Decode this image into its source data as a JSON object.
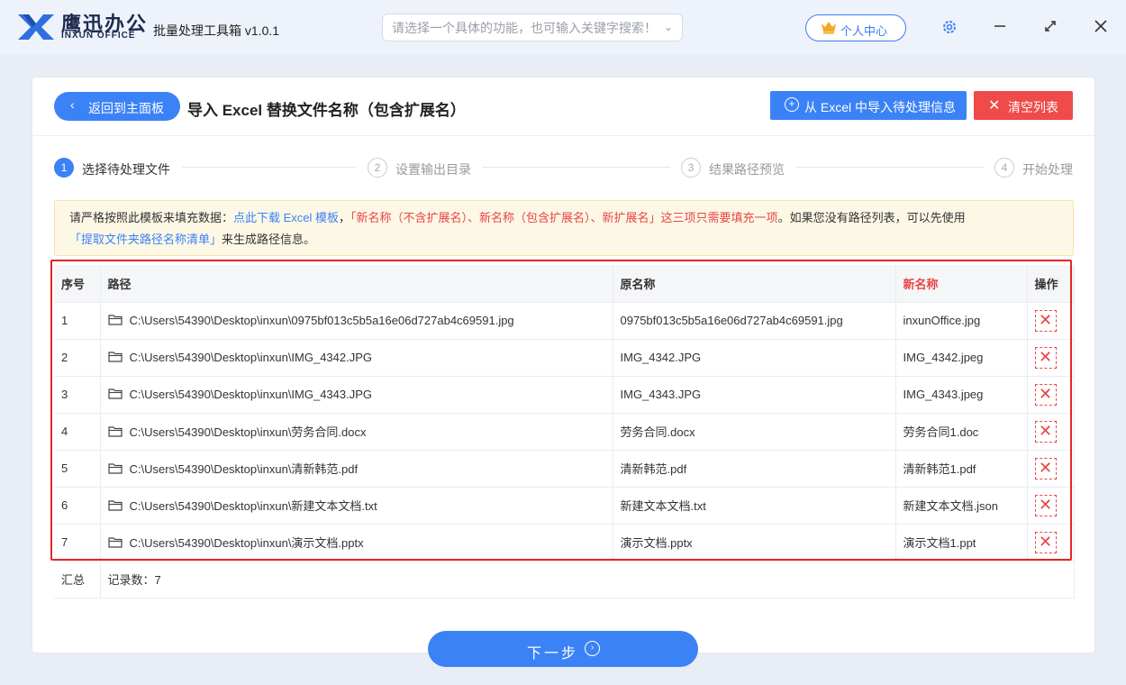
{
  "titlebar": {
    "brand_cn": "鹰迅办公",
    "brand_en": "INXUN OFFICE",
    "app_title": "批量处理工具箱 v1.0.1",
    "search_placeholder": "请选择一个具体的功能，也可输入关键字搜索！",
    "user_center": "个人中心"
  },
  "header": {
    "back_label": "返回到主面板",
    "page_title": "导入 Excel 替换文件名称（包含扩展名）",
    "import_label": "从 Excel 中导入待处理信息",
    "clear_label": "清空列表"
  },
  "steps": [
    {
      "num": "1",
      "label": "选择待处理文件"
    },
    {
      "num": "2",
      "label": "设置输出目录"
    },
    {
      "num": "3",
      "label": "结果路径预览"
    },
    {
      "num": "4",
      "label": "开始处理"
    }
  ],
  "notice": {
    "part1": "请严格按照此模板来填充数据：",
    "link1": "点此下载 Excel 模板",
    "part2": "，",
    "red": "「新名称（不含扩展名）、新名称（包含扩展名）、新扩展名」这三项只需要填充一项",
    "part3": "。如果您没有路径列表，可以先使用",
    "link2": "「提取文件夹路径名称清单」",
    "part4": "来生成路径信息。"
  },
  "table": {
    "headers": {
      "index": "序号",
      "path": "路径",
      "original": "原名称",
      "newname": "新名称",
      "action": "操作"
    },
    "rows": [
      {
        "index": "1",
        "path": "C:\\Users\\54390\\Desktop\\inxun\\0975bf013c5b5a16e06d727ab4c69591.jpg",
        "original": "0975bf013c5b5a16e06d727ab4c69591.jpg",
        "newname": "inxunOffice.jpg"
      },
      {
        "index": "2",
        "path": "C:\\Users\\54390\\Desktop\\inxun\\IMG_4342.JPG",
        "original": "IMG_4342.JPG",
        "newname": "IMG_4342.jpeg"
      },
      {
        "index": "3",
        "path": "C:\\Users\\54390\\Desktop\\inxun\\IMG_4343.JPG",
        "original": "IMG_4343.JPG",
        "newname": "IMG_4343.jpeg"
      },
      {
        "index": "4",
        "path": "C:\\Users\\54390\\Desktop\\inxun\\劳务合同.docx",
        "original": "劳务合同.docx",
        "newname": "劳务合同1.doc"
      },
      {
        "index": "5",
        "path": "C:\\Users\\54390\\Desktop\\inxun\\清新韩范.pdf",
        "original": "清新韩范.pdf",
        "newname": "清新韩范1.pdf"
      },
      {
        "index": "6",
        "path": "C:\\Users\\54390\\Desktop\\inxun\\新建文本文档.txt",
        "original": "新建文本文档.txt",
        "newname": "新建文本文档.json"
      },
      {
        "index": "7",
        "path": "C:\\Users\\54390\\Desktop\\inxun\\演示文档.pptx",
        "original": "演示文档.pptx",
        "newname": "演示文档1.ppt"
      }
    ],
    "summary_label": "汇总",
    "summary_count": "记录数：7"
  },
  "footer": {
    "next_label": "下一步"
  },
  "colors": {
    "primary": "#3b82f6",
    "danger": "#f04a4a",
    "highlight": "#e52525"
  }
}
